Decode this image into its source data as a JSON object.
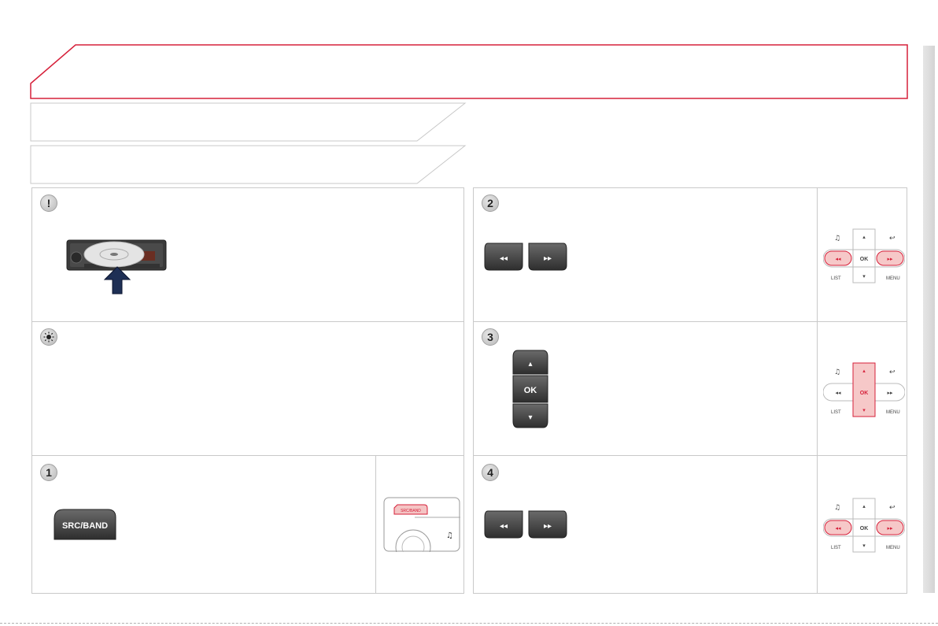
{
  "page": {
    "accent_color": "#d6203a",
    "title": "",
    "section_ribbons": [
      "",
      ""
    ]
  },
  "panels": {
    "warning": {
      "icon": "exclamation-icon",
      "text": ""
    },
    "tip": {
      "icon": "lightbulb-icon",
      "text": ""
    },
    "step1": {
      "number": "1",
      "button_label": "SRC/BAND",
      "text": ""
    },
    "step2": {
      "number": "2",
      "text": ""
    },
    "step3": {
      "number": "3",
      "center_label": "OK",
      "text": ""
    },
    "step4": {
      "number": "4",
      "text": ""
    }
  },
  "controls": {
    "ok_label": "OK",
    "list_label": "LIST",
    "menu_label": "MENU",
    "src_band_small": "SRC/BAND"
  }
}
